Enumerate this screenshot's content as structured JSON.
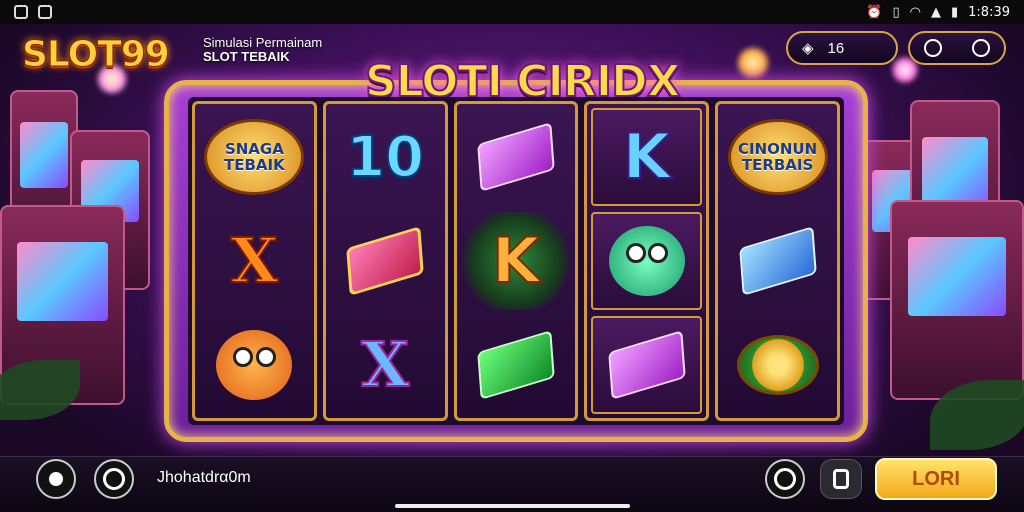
{
  "status_bar": {
    "time": "1:8:39"
  },
  "header": {
    "logo": "SLOT99",
    "tagline_line1": "Simulasi Permainam",
    "tagline_line2": "SLOT TEBAIK",
    "balance_label": "16",
    "game_title": "SLOTI CIRIDX"
  },
  "reels": [
    [
      "SNAGA TEBAIK",
      "X",
      "face-orange"
    ],
    [
      "10",
      "gem-chest",
      "X"
    ],
    [
      "gem-purple",
      "K",
      "gem-green"
    ],
    [
      "K",
      "face-green",
      "gem-purple"
    ],
    [
      "CINONUN TERBAIS",
      "gem-blue",
      "coin-green"
    ]
  ],
  "symbols": {
    "badge1_line1": "SNAGA",
    "badge1_line2": "TEBAIK",
    "x1": "X",
    "ten": "10",
    "x2": "X",
    "k1": "K",
    "k2": "K",
    "badge2_line1": "CINONUN",
    "badge2_line2": "TERBAIS"
  },
  "bottom": {
    "username": "Jhohatdrα0m",
    "login_label": "LORI"
  },
  "colors": {
    "accent_gold": "#e8b24a",
    "frame_purple": "#a63fd6",
    "login_yellow": "#ffd34a"
  }
}
